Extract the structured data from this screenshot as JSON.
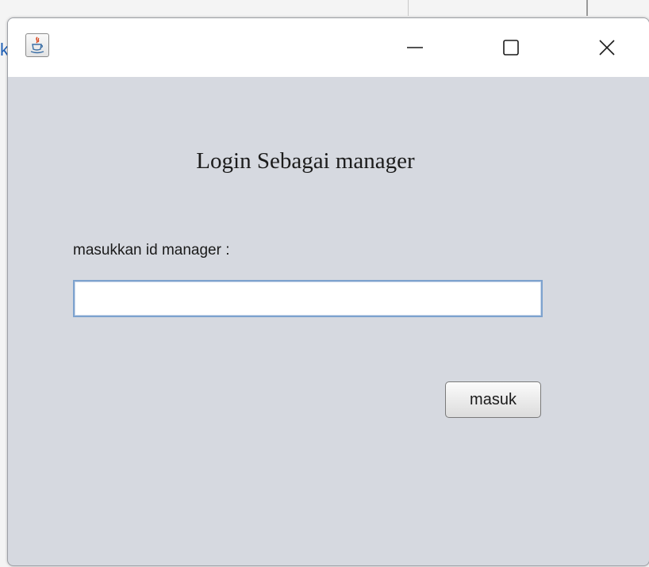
{
  "background": {
    "partial_text": "ka"
  },
  "window": {
    "icon": "java-coffee-icon",
    "controls": {
      "minimize": "minimize-icon",
      "maximize": "maximize-icon",
      "close": "close-icon"
    }
  },
  "form": {
    "heading": "Login Sebagai manager",
    "id_label": "masukkan id manager :",
    "id_value": "",
    "submit_label": "masuk"
  },
  "colors": {
    "window_bg": "#d6d9e0",
    "titlebar_bg": "#ffffff",
    "input_border": "#7da2ce"
  }
}
